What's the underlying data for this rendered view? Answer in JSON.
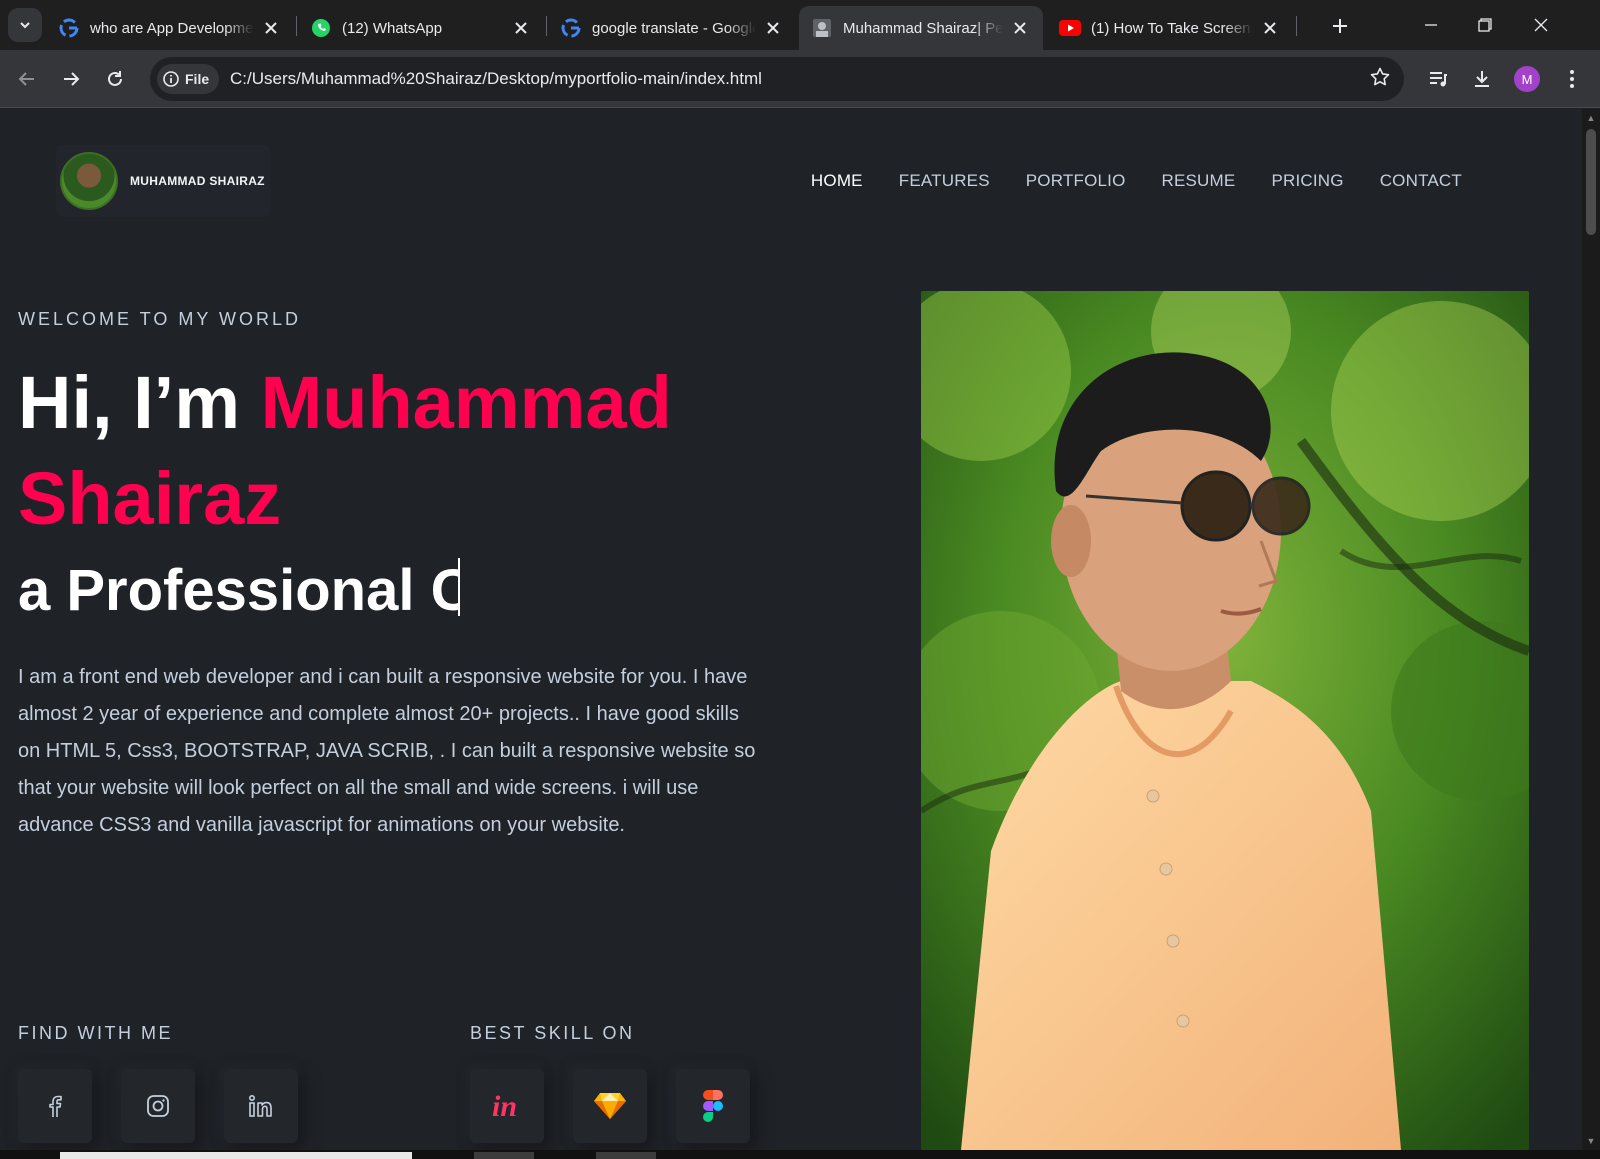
{
  "browser": {
    "tabs": [
      {
        "title": "who are App Developmer",
        "favicon": "google-icon",
        "active": false
      },
      {
        "title": "(12) WhatsApp",
        "favicon": "whatsapp-icon",
        "active": false
      },
      {
        "title": "google translate - Google",
        "favicon": "google-icon",
        "active": false
      },
      {
        "title": "Muhammad Shairaz| Pers",
        "favicon": "site-icon",
        "active": true
      },
      {
        "title": "(1) How To Take Screensh",
        "favicon": "youtube-icon",
        "active": false
      }
    ],
    "chip_label": "File",
    "url": "C:/Users/Muhammad%20Shairaz/Desktop/myportfolio-main/index.html",
    "profile_initial": "M",
    "profile_color": "#a142c9"
  },
  "site": {
    "brand_name": "MUHAMMAD SHAIRAZ",
    "nav": [
      "HOME",
      "FEATURES",
      "PORTFOLIO",
      "RESUME",
      "PRICING",
      "CONTACT"
    ],
    "welcome": "WELCOME TO MY WORLD",
    "greeting": "Hi, I’m ",
    "name": "Muhammad Shairaz",
    "typed_text": "a Professional C",
    "description": "I am a front end web developer and i can built a responsive website for you. I have almost 2 year of experience and complete almost 20+ projects.. I have good skills on HTML 5, Css3, BOOTSTRAP, JAVA SCRIB, . I can built a responsive website so that your website will look perfect on all the small and wide screens. i will use advance CSS3 and vanilla javascript for animations on your website.",
    "find_label": "FIND WITH ME",
    "skill_label": "BEST SKILL ON",
    "social_icons": [
      "facebook-icon",
      "instagram-icon",
      "linkedin-icon"
    ],
    "skill_icons": [
      "invision-icon",
      "sketch-icon",
      "figma-icon"
    ],
    "accent_color": "#ff014f"
  }
}
